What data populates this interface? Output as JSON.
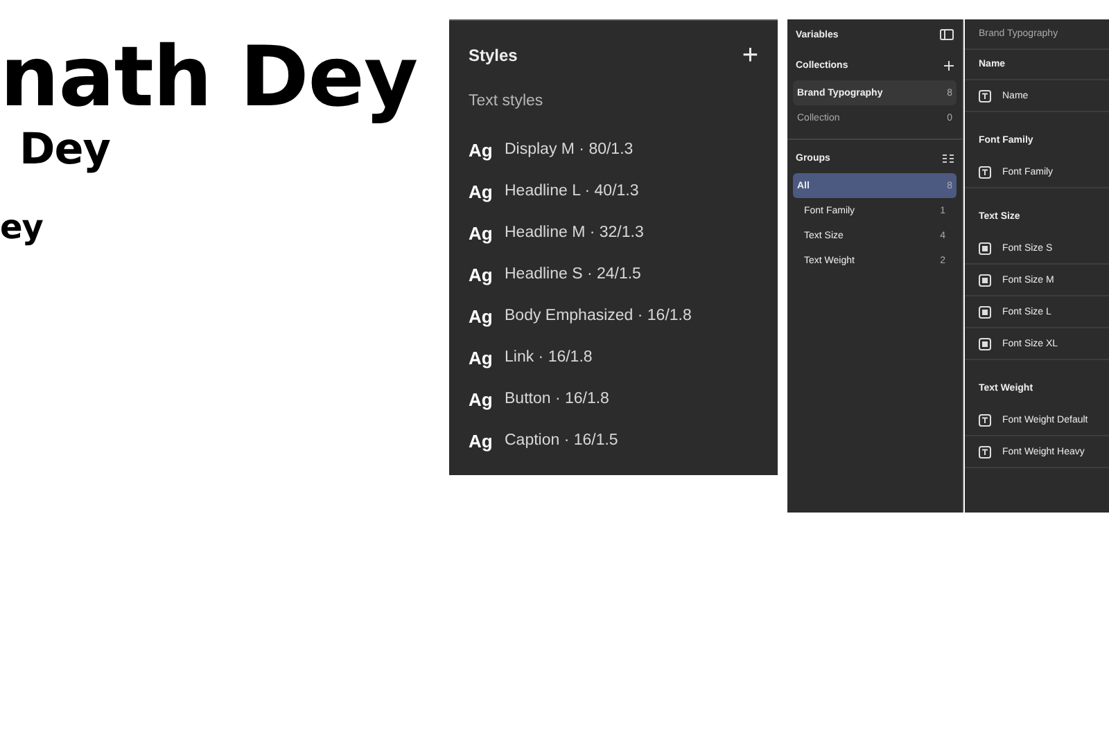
{
  "canvas_text": [
    {
      "text": "nath Dey",
      "kind": "large"
    },
    {
      "text": "Dey",
      "kind": "medium"
    },
    {
      "text": "ey",
      "kind": "small"
    }
  ],
  "styles_panel": {
    "title": "Styles",
    "add_icon": "+",
    "section": "Text styles",
    "items": [
      {
        "sample": "Ag",
        "label": "Display M · 80/1.3"
      },
      {
        "sample": "Ag",
        "label": "Headline L · 40/1.3"
      },
      {
        "sample": "Ag",
        "label": "Headline M · 32/1.3"
      },
      {
        "sample": "Ag",
        "label": "Headline S · 24/1.5"
      },
      {
        "sample": "Ag",
        "label": "Body Emphasized · 16/1.8"
      },
      {
        "sample": "Ag",
        "label": "Link · 16/1.8"
      },
      {
        "sample": "Ag",
        "label": "Button · 16/1.8"
      },
      {
        "sample": "Ag",
        "label": "Caption · 16/1.5"
      }
    ]
  },
  "variables_panel": {
    "title": "Variables",
    "collections_title": "Collections",
    "collections": [
      {
        "name": "Brand Typography",
        "count": "8",
        "selected": true
      },
      {
        "name": "Collection",
        "count": "0",
        "selected": false
      }
    ],
    "groups_title": "Groups",
    "groups": [
      {
        "name": "All",
        "count": "8",
        "selected": true
      },
      {
        "name": "Font Family",
        "count": "1",
        "selected": false
      },
      {
        "name": "Text Size",
        "count": "4",
        "selected": false
      },
      {
        "name": "Text Weight",
        "count": "2",
        "selected": false
      }
    ]
  },
  "variables_table": {
    "collection": "Brand Typography",
    "groups": [
      {
        "title": "Name",
        "variables": [
          {
            "name": "Name",
            "kind": "string"
          }
        ]
      },
      {
        "title": "Font Family",
        "variables": [
          {
            "name": "Font Family",
            "kind": "string"
          }
        ]
      },
      {
        "title": "Text Size",
        "variables": [
          {
            "name": "Font Size S",
            "kind": "number"
          },
          {
            "name": "Font Size M",
            "kind": "number"
          },
          {
            "name": "Font Size L",
            "kind": "number"
          },
          {
            "name": "Font Size XL",
            "kind": "number"
          }
        ]
      },
      {
        "title": "Text Weight",
        "variables": [
          {
            "name": "Font Weight Default",
            "kind": "string"
          },
          {
            "name": "Font Weight Heavy",
            "kind": "string"
          }
        ]
      }
    ]
  }
}
